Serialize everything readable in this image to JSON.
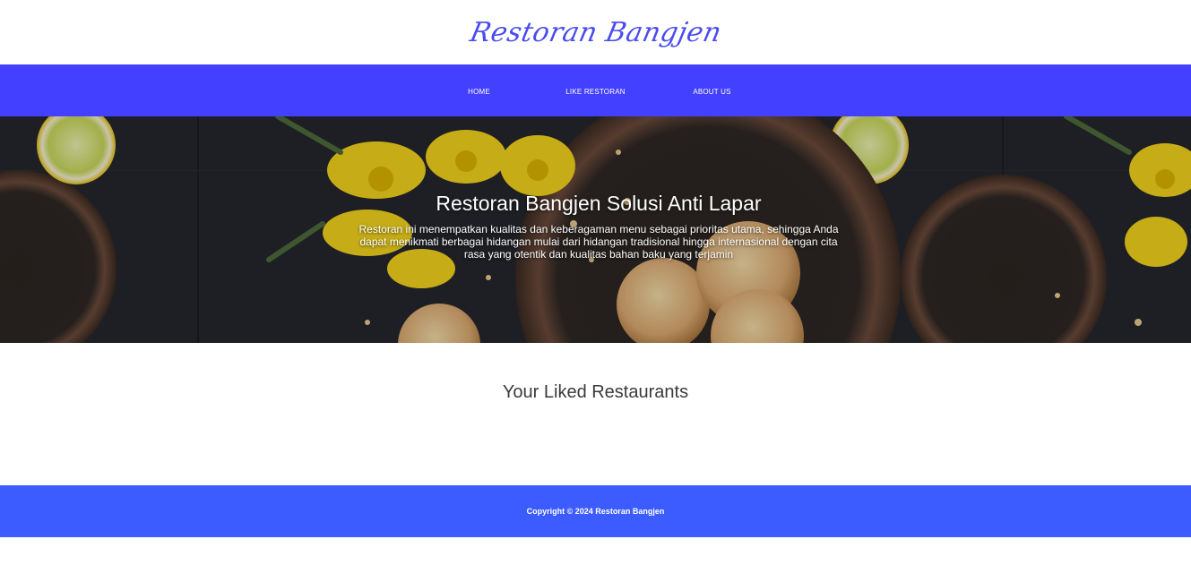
{
  "header": {
    "logo_text": "Restoran Bangjen"
  },
  "nav": {
    "items": [
      {
        "label": "HOME"
      },
      {
        "label": "LIKE RESTORAN"
      },
      {
        "label": "ABOUT US"
      }
    ]
  },
  "hero": {
    "title": "Restoran Bangjen Solusi Anti Lapar",
    "text": "Restoran ini menempatkan kualitas dan keberagaman menu sebagai prioritas utama, sehingga Anda dapat menikmati berbagai hidangan mulai dari hidangan tradisional hingga internasional dengan cita rasa yang otentik dan kualitas bahan baku yang terjamin"
  },
  "main": {
    "section_title": "Your Liked Restaurants"
  },
  "footer": {
    "copyright": "Copyright © 2024 Restoran Bangjen"
  },
  "colors": {
    "nav_background": "#4440ff",
    "footer_background": "#3d5cff",
    "logo": "#4b4cf0"
  }
}
